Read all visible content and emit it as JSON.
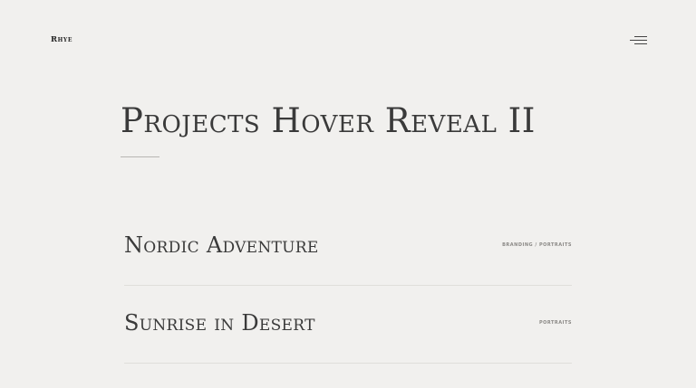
{
  "header": {
    "logo": "Rhye",
    "menu_icon": "hamburger-menu-icon"
  },
  "page": {
    "title": "Projects Hover Reveal II"
  },
  "projects": [
    {
      "name": "Nordic Adventure",
      "categories": "Branding / Portraits"
    },
    {
      "name": "Sunrise in Desert",
      "categories": "Portraits"
    }
  ],
  "colors": {
    "background": "#f1f0ee",
    "text": "#3a3a3a",
    "muted": "#8a8885",
    "divider": "#dfdeda"
  }
}
